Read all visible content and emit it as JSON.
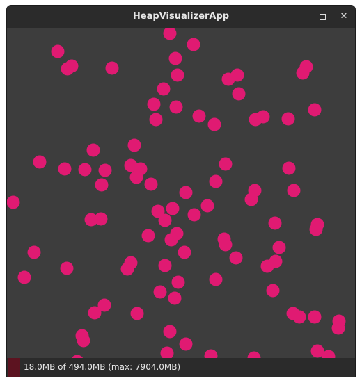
{
  "window": {
    "title": "HeapVisualizerApp",
    "controls": {
      "minimize": "minimize",
      "maximize": "maximize",
      "close": "close"
    }
  },
  "colors": {
    "ball": "#e01a72",
    "canvas_bg": "#3d3d3d",
    "titlebar_bg": "#2b2b2b",
    "heap_indicator": "#5c1320"
  },
  "status": {
    "heap_text": "18.0MB of 494.0MB (max: 7904.0MB)"
  }
}
